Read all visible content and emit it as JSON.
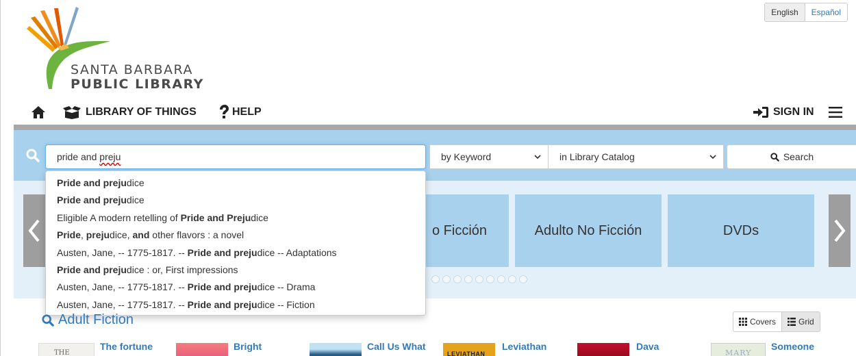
{
  "language": {
    "active": "English",
    "other": "Español"
  },
  "logo": {
    "line1": "SANTA BARBARA",
    "line2": "PUBLIC LIBRARY"
  },
  "nav": {
    "home_icon": "home-icon",
    "library_of_things": "LIBRARY OF THINGS",
    "help": "HELP",
    "sign_in": "SIGN IN",
    "menu_icon": "hamburger-icon"
  },
  "search": {
    "value_part1": "pride and ",
    "value_part2": "preju",
    "type_select": "by Keyword",
    "scope_select": "in Library Catalog",
    "button_label": "Search"
  },
  "autocomplete": [
    {
      "segments": [
        {
          "t": "Pride and preju",
          "b": true
        },
        {
          "t": "dice",
          "b": false
        }
      ]
    },
    {
      "segments": [
        {
          "t": "Pride and preju",
          "b": true
        },
        {
          "t": "dice",
          "b": false
        }
      ]
    },
    {
      "segments": [
        {
          "t": "Eligible A modern retelling of ",
          "b": false
        },
        {
          "t": "Pride and Preju",
          "b": true
        },
        {
          "t": "dice",
          "b": false
        }
      ]
    },
    {
      "segments": [
        {
          "t": "Pride",
          "b": true
        },
        {
          "t": ", ",
          "b": false
        },
        {
          "t": "preju",
          "b": true
        },
        {
          "t": "dice, ",
          "b": false
        },
        {
          "t": "and",
          "b": true
        },
        {
          "t": " other flavors : a novel",
          "b": false
        }
      ]
    },
    {
      "segments": [
        {
          "t": "Austen, Jane, -- 1775-1817. -- ",
          "b": false
        },
        {
          "t": "Pride and preju",
          "b": true
        },
        {
          "t": "dice -- Adaptations",
          "b": false
        }
      ]
    },
    {
      "segments": [
        {
          "t": "Pride and preju",
          "b": true
        },
        {
          "t": "dice : or, First impressions",
          "b": false
        }
      ]
    },
    {
      "segments": [
        {
          "t": "Austen, Jane, -- 1775-1817. -- ",
          "b": false
        },
        {
          "t": "Pride and preju",
          "b": true
        },
        {
          "t": "dice -- Drama",
          "b": false
        }
      ]
    },
    {
      "segments": [
        {
          "t": "Austen, Jane, -- 1775-1817. -- ",
          "b": false
        },
        {
          "t": "Pride and preju",
          "b": true
        },
        {
          "t": "dice -- Fiction",
          "b": false
        }
      ]
    }
  ],
  "carousel": {
    "tiles": [
      "o Ficción",
      "Adulto No Ficción",
      "DVDs"
    ],
    "dot_count": 9
  },
  "section": {
    "title": "Adult Fiction"
  },
  "view_toggle": {
    "covers": "Covers",
    "grid": "Grid"
  },
  "books": [
    {
      "title": "The fortune",
      "cover_text": "THE"
    },
    {
      "title": "Bright"
    },
    {
      "title": "Call Us What"
    },
    {
      "title": "Leviathan",
      "cover_text": "LEVIATHAN"
    },
    {
      "title": "Dava"
    },
    {
      "title": "Someone",
      "cover_text": "MARY"
    }
  ]
}
